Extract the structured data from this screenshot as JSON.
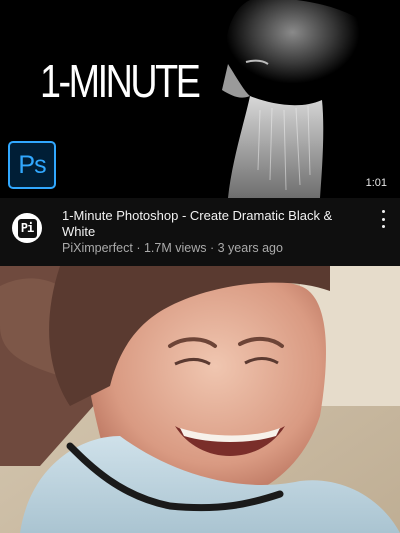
{
  "video": {
    "thumbnail_text": "1-MINUTE",
    "badge_text": "Ps",
    "duration": "1:01",
    "title": "1-Minute Photoshop - Create Dramatic Black & White",
    "channel": "PiXimperfect",
    "views": "1.7M views",
    "age": "3 years ago",
    "channel_avatar_text": "Pi",
    "separator": " · "
  },
  "colors": {
    "background": "#0f0f0f",
    "title_text": "#f1f1f1",
    "secondary_text": "#aaaaaa",
    "ps_blue": "#31a8ff",
    "ps_dark": "#001e36"
  },
  "icons": [
    "photoshop-logo-icon",
    "channel-logo-icon",
    "more-options-icon"
  ]
}
